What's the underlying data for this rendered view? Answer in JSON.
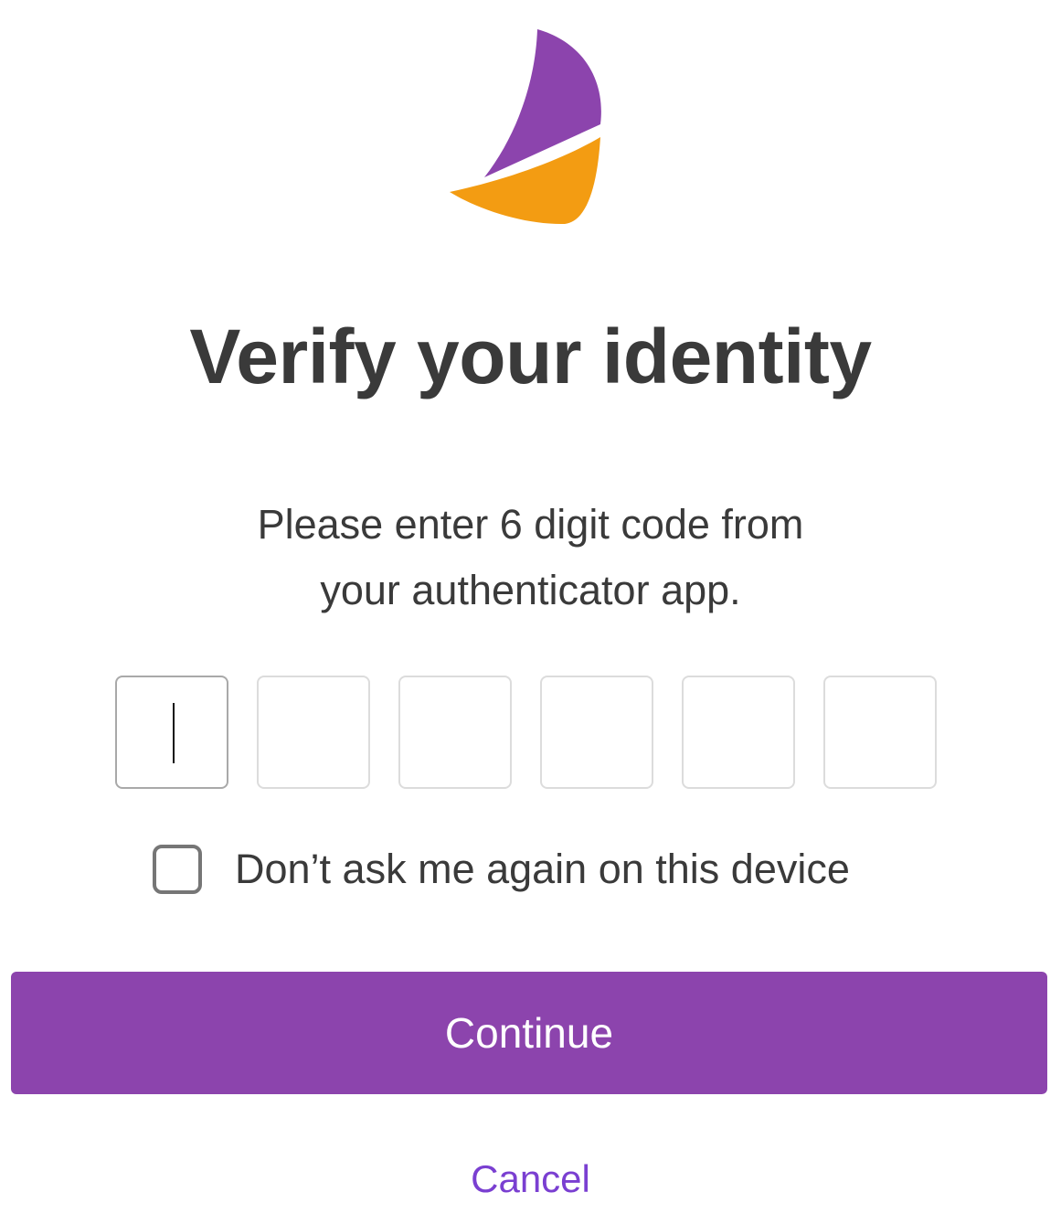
{
  "brand": {
    "logo_icon": "sailboat-logo-icon",
    "colors": {
      "purple": "#8c44ad",
      "orange": "#f39c12",
      "link": "#7a3fd1"
    }
  },
  "page": {
    "title": "Verify your identity",
    "instructions_line1": "Please enter 6 digit code from",
    "instructions_line2": "your authenticator app."
  },
  "otp": {
    "length": 6,
    "active_index": 0,
    "digits": [
      "",
      "",
      "",
      "",
      "",
      ""
    ]
  },
  "remember_device": {
    "label": "Don’t ask me again on this device",
    "checked": false
  },
  "actions": {
    "continue_label": "Continue",
    "cancel_label": "Cancel"
  }
}
